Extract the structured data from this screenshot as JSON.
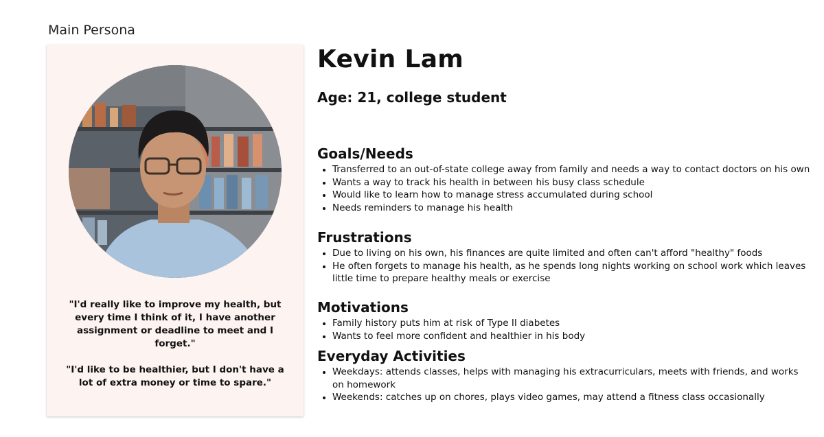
{
  "page_label": "Main Persona",
  "persona": {
    "name": "Kevin Lam",
    "age_line": "Age: 21, college student"
  },
  "quotes": [
    "\"I'd really like to improve my health, but every time I think of it, I have another assignment or deadline to meet and I forget.\"",
    "\"I'd like to be healthier, but I don't have a lot of extra money or time to spare.\""
  ],
  "sections": {
    "goals": {
      "title": "Goals/Needs",
      "items": [
        "Transferred to an out-of-state college away from family and needs a way to contact doctors on his own",
        "Wants a way to track his health in between his busy class schedule",
        "Would like to learn how to manage stress accumulated during school",
        "Needs reminders to manage his health"
      ]
    },
    "frustrations": {
      "title": "Frustrations",
      "items": [
        "Due to living on his own, his finances are quite limited and often can't afford \"healthy\" foods",
        "He often forgets to manage his health, as he spends long nights working on school work which leaves little time to prepare healthy meals or exercise"
      ]
    },
    "motivations": {
      "title": "Motivations",
      "items": [
        "Family history puts him at risk of Type II diabetes",
        "Wants to feel more confident and healthier in his body"
      ]
    },
    "activities": {
      "title": "Everyday Activities",
      "items": [
        "Weekdays: attends classes, helps with managing his extracurriculars, meets with friends, and works on homework",
        "Weekends: catches up on chores, plays video games, may attend a fitness class occasionally"
      ]
    }
  },
  "colors": {
    "card_background": "#fdf3f0",
    "text": "#111111"
  }
}
